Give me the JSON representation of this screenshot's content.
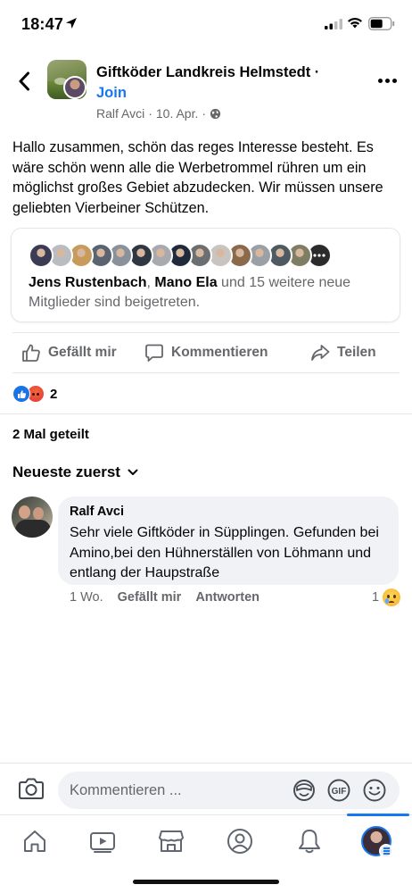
{
  "status_bar": {
    "time": "18:47"
  },
  "header": {
    "group_name": "Giftköder Landkreis Helmstedt ·",
    "join_label": "Join",
    "author": "Ralf Avci",
    "date": "10. Apr.",
    "separator": "·"
  },
  "post": {
    "text": "Hallo zusammen, schön das reges Interesse besteht. Es wäre schön wenn alle die Werbetrommel rühren um ein möglichst großes Gebiet abzudecken. Wir müssen unsere geliebten Vierbeiner Schützen."
  },
  "joined_card": {
    "name_1": "Jens Rustenbach",
    "comma": ", ",
    "name_2": "Mano Ela",
    "rest": " und 15 weitere neue Mitglieder sind beigetreten.",
    "avatar_colors": [
      "#3a3c55",
      "#b9bcc1",
      "#c79b5b",
      "#5a6470",
      "#89929c",
      "#2f3742",
      "#a8aab0",
      "#1f2a3a",
      "#6c6f72",
      "#c9c4c0",
      "#8b6a4c",
      "#9aa0a6",
      "#4d5a62",
      "#7d7e64",
      "#2b2b2b"
    ]
  },
  "actions": {
    "like": "Gefällt mir",
    "comment": "Kommentieren",
    "share": "Teilen"
  },
  "reactions": {
    "count": "2"
  },
  "shares": {
    "label": "2 Mal geteilt"
  },
  "sort": {
    "label": "Neueste zuerst"
  },
  "comment": {
    "author": "Ralf Avci",
    "text": "Sehr viele Giftköder in Süpplingen. Gefunden bei Amino,bei den Hühnerställen von Löhmann und entlang der Haupstraße",
    "time": "1 Wo.",
    "like": "Gefällt mir",
    "reply": "Antworten",
    "reaction_count": "1"
  },
  "composer": {
    "placeholder": "Kommentieren ..."
  },
  "colors": {
    "accent": "#1877f2",
    "secondary_text": "#65676b",
    "bubble": "#f0f2f5"
  },
  "icons": {
    "status": [
      "location-arrow-icon",
      "signal-icon",
      "wifi-icon",
      "battery-icon"
    ],
    "header": [
      "back-chevron-icon",
      "globe-icon",
      "more-icon"
    ],
    "tabs": [
      "home-icon",
      "video-icon",
      "marketplace-icon",
      "profile-icon",
      "bell-icon",
      "menu-profile-icon"
    ]
  }
}
